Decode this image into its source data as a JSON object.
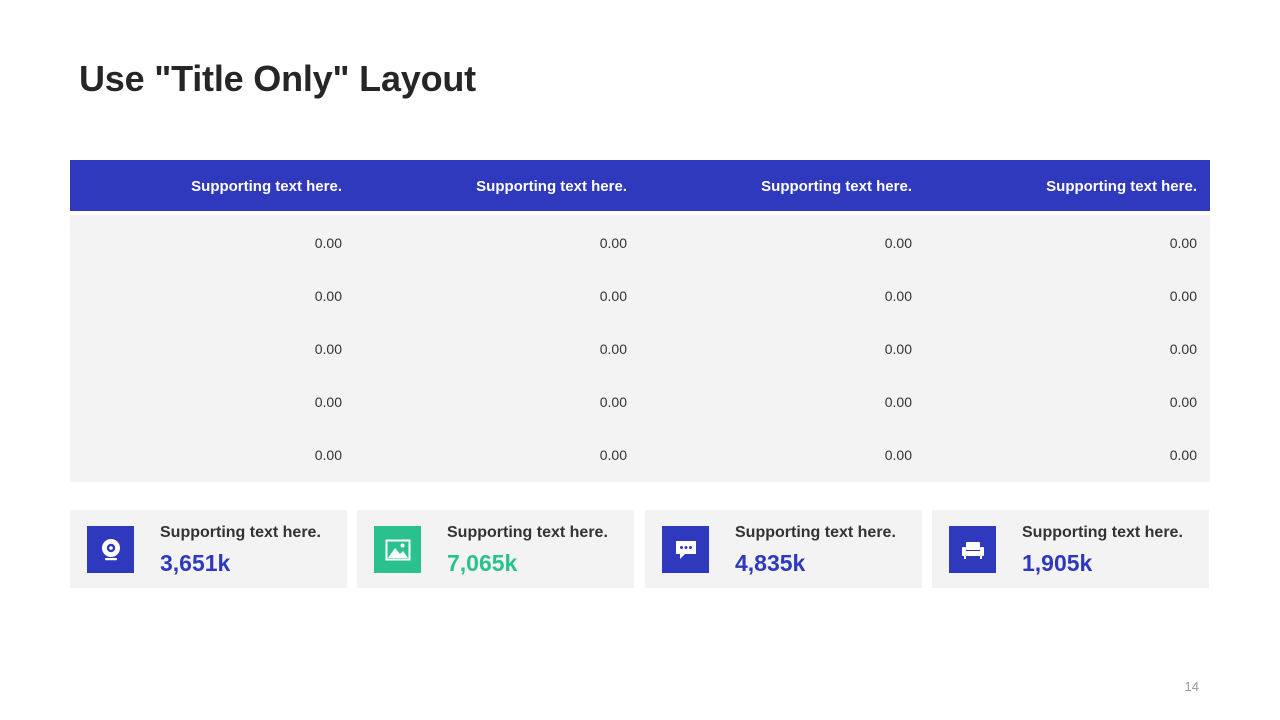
{
  "title": "Use \"Title Only\" Layout",
  "colors": {
    "primary": "#2f39bd",
    "accent": "#2bc18e",
    "panel": "#f3f3f3",
    "text": "#333333"
  },
  "table": {
    "headers": [
      "Supporting text here.",
      "Supporting text here.",
      "Supporting text here.",
      "Supporting text here."
    ],
    "rows": [
      [
        "0.00",
        "0.00",
        "0.00",
        "0.00"
      ],
      [
        "0.00",
        "0.00",
        "0.00",
        "0.00"
      ],
      [
        "0.00",
        "0.00",
        "0.00",
        "0.00"
      ],
      [
        "0.00",
        "0.00",
        "0.00",
        "0.00"
      ],
      [
        "0.00",
        "0.00",
        "0.00",
        "0.00"
      ]
    ]
  },
  "cards": [
    {
      "label": "Supporting text here.",
      "value": "3,651k",
      "icon": "webcam-icon",
      "color": "#2f39bd"
    },
    {
      "label": "Supporting text here.",
      "value": "7,065k",
      "icon": "image-icon",
      "color": "#2bc18e"
    },
    {
      "label": "Supporting text here.",
      "value": "4,835k",
      "icon": "chat-bubble-icon",
      "color": "#2f39bd"
    },
    {
      "label": "Supporting text here.",
      "value": "1,905k",
      "icon": "sofa-icon",
      "color": "#2f39bd"
    }
  ],
  "page_number": "14"
}
